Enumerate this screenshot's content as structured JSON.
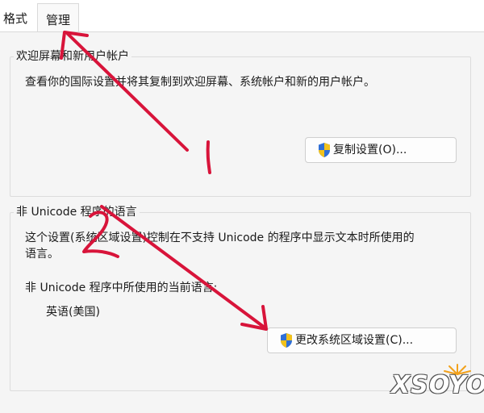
{
  "tabs": [
    "格式",
    "管理"
  ],
  "groups": {
    "welcome": {
      "title": "欢迎屏幕和新用户帐户",
      "description": "查看你的国际设置并将其复制到欢迎屏幕、系统帐户和新的用户帐户。",
      "button_label": "复制设置(O)..."
    },
    "non_unicode": {
      "title": "非 Unicode 程序的语言",
      "description_line1": "这个设置(系统区域设置)控制在不支持 Unicode 的程序中显示文本时所使用的",
      "description_line2": "语言。",
      "current_label": "非 Unicode 程序中所使用的当前语言:",
      "current_value": "英语(美国)",
      "button_label": "更改系统区域设置(C)..."
    }
  },
  "annotations": {
    "mark1": "1",
    "mark2": "2"
  },
  "watermark": "XSOYO",
  "colors": {
    "annotation": "#d8143a",
    "shield_blue": "#2f6fd6",
    "shield_yellow": "#f2c21b"
  },
  "icons": [
    "uac-shield-icon",
    "uac-shield-icon"
  ]
}
